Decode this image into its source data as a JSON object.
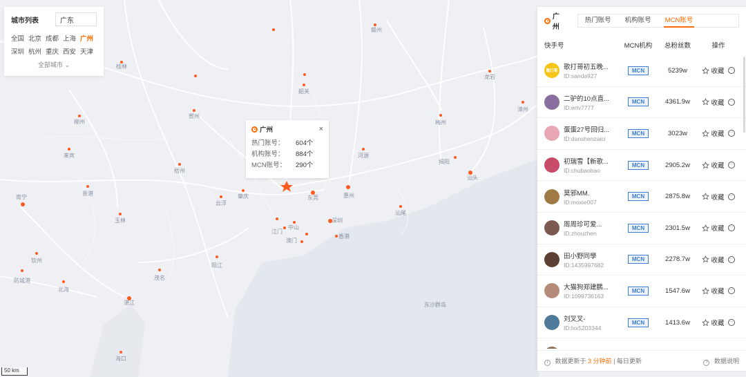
{
  "city_panel": {
    "title": "城市列表",
    "search_value": "广东",
    "cities": [
      "全国",
      "北京",
      "成都",
      "上海",
      "广州",
      "深圳",
      "杭州",
      "重庆",
      "西安",
      "天津"
    ],
    "active_city": "广州",
    "all_cities_label": "全部城市"
  },
  "popup": {
    "city": "广州",
    "close": "×",
    "rows": [
      {
        "k": "热门账号：",
        "v": "604个"
      },
      {
        "k": "机构账号：",
        "v": "884个"
      },
      {
        "k": "MCN账号：",
        "v": "290个"
      }
    ]
  },
  "map": {
    "scale_label": "50 km",
    "cities": [
      {
        "name": "桂林"
      },
      {
        "name": "韶关"
      },
      {
        "name": "赣州"
      },
      {
        "name": "龙岩"
      },
      {
        "name": "贺州"
      },
      {
        "name": "柳州"
      },
      {
        "name": "梧州"
      },
      {
        "name": "来宾"
      },
      {
        "name": "南宁"
      },
      {
        "name": "贵港"
      },
      {
        "name": "玉林"
      },
      {
        "name": "云浮"
      },
      {
        "name": "肇庆"
      },
      {
        "name": "东莞"
      },
      {
        "name": "惠州"
      },
      {
        "name": "河源"
      },
      {
        "name": "梅州"
      },
      {
        "name": "揭阳"
      },
      {
        "name": "汕头"
      },
      {
        "name": "汕尾"
      },
      {
        "name": "中山"
      },
      {
        "name": "深圳"
      },
      {
        "name": "澳门"
      },
      {
        "name": "香港"
      },
      {
        "name": "江门"
      },
      {
        "name": "阳江"
      },
      {
        "name": "茂名"
      },
      {
        "name": "湛江"
      },
      {
        "name": "钦州"
      },
      {
        "name": "北海"
      },
      {
        "name": "防城港"
      },
      {
        "name": "海口"
      },
      {
        "name": "漳州"
      },
      {
        "name": "清远"
      },
      {
        "name": "珠海"
      }
    ]
  },
  "right_panel": {
    "city": "广州",
    "tabs": [
      "热门账号",
      "机构账号",
      "MCN账号"
    ],
    "active_tab": 2,
    "headers": {
      "name": "快手号",
      "mcn": "MCN机构",
      "fans": "总粉丝数",
      "op": "操作"
    },
    "rows": [
      {
        "name": "歌打哥初五晚...",
        "id": "ID:sanda927",
        "mcn": "MCN",
        "fans": "5239w",
        "op": "收藏",
        "avatar_color": "#f5c518",
        "avatar_text": "歌打哥"
      },
      {
        "name": "二驴的10点直...",
        "id": "ID:ertv7777",
        "mcn": "MCN",
        "fans": "4361.9w",
        "op": "收藏",
        "avatar_color": "#8a6f9e",
        "avatar_text": ""
      },
      {
        "name": "蛋蛋27号回归...",
        "id": "ID:danshenzaici",
        "mcn": "MCN",
        "fans": "3023w",
        "op": "收藏",
        "avatar_color": "#e9a7b5",
        "avatar_text": ""
      },
      {
        "name": "初瑞雪【新歌...",
        "id": "ID:chubaobao",
        "mcn": "MCN",
        "fans": "2905.2w",
        "op": "收藏",
        "avatar_color": "#c94b6a",
        "avatar_text": ""
      },
      {
        "name": "莫邪MM.",
        "id": "ID:moxie007",
        "mcn": "MCN",
        "fans": "2875.8w",
        "op": "收藏",
        "avatar_color": "#a07a45",
        "avatar_text": ""
      },
      {
        "name": "周周珍可爱...",
        "id": "ID:zhouzhen",
        "mcn": "MCN",
        "fans": "2301.5w",
        "op": "收藏",
        "avatar_color": "#7d5a50",
        "avatar_text": ""
      },
      {
        "name": "田小野同學",
        "id": "ID:1435997682",
        "mcn": "MCN",
        "fans": "2278.7w",
        "op": "收藏",
        "avatar_color": "#5c4033",
        "avatar_text": ""
      },
      {
        "name": "大猫狗郑建鹏...",
        "id": "ID:1099736163",
        "mcn": "MCN",
        "fans": "1547.6w",
        "op": "收藏",
        "avatar_color": "#b58b7a",
        "avatar_text": ""
      },
      {
        "name": "刘叉叉-",
        "id": "ID:lxx5203344",
        "mcn": "MCN",
        "fans": "1413.6w",
        "op": "收藏",
        "avatar_color": "#4f7a9a",
        "avatar_text": ""
      },
      {
        "name": "赵梦澈❤️周",
        "id": "",
        "mcn": "MCN",
        "fans": "",
        "op": "",
        "avatar_color": "#8c6d5a",
        "avatar_text": ""
      }
    ],
    "footer": {
      "update_prefix": "数据更新于",
      "update_time": "3 分钟前",
      "update_suffix": "| 每日更新",
      "help": "数据说明"
    }
  },
  "colors": {
    "accent": "#ff6a00",
    "mcn_badge": "#3a7bd5"
  }
}
